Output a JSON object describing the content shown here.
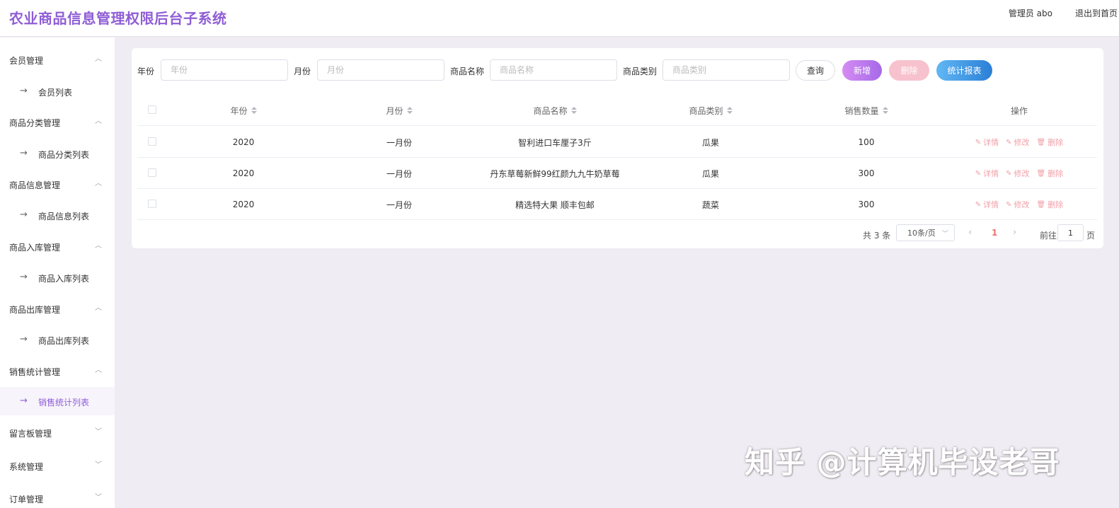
{
  "header": {
    "title": "农业商品信息管理权限后台子系统",
    "user": "管理员 abo",
    "logout": "退出到首页"
  },
  "sidebar": {
    "groups": [
      {
        "title": "会员管理",
        "expanded": true,
        "sub": "会员列表"
      },
      {
        "title": "商品分类管理",
        "expanded": true,
        "sub": "商品分类列表"
      },
      {
        "title": "商品信息管理",
        "expanded": true,
        "sub": "商品信息列表"
      },
      {
        "title": "商品入库管理",
        "expanded": true,
        "sub": "商品入库列表"
      },
      {
        "title": "商品出库管理",
        "expanded": true,
        "sub": "商品出库列表"
      },
      {
        "title": "销售统计管理",
        "expanded": true,
        "sub": "销售统计列表",
        "active": true
      },
      {
        "title": "留言板管理",
        "expanded": false
      },
      {
        "title": "系统管理",
        "expanded": false
      },
      {
        "title": "订单管理",
        "expanded": false
      }
    ]
  },
  "filters": {
    "year_label": "年份",
    "year_placeholder": "年份",
    "month_label": "月份",
    "month_placeholder": "月份",
    "name_label": "商品名称",
    "name_placeholder": "商品名称",
    "category_label": "商品类别",
    "category_placeholder": "商品类别"
  },
  "buttons": {
    "query": "查询",
    "add": "新增",
    "delete": "删除",
    "stats": "统计报表"
  },
  "table": {
    "columns": [
      "年份",
      "月份",
      "商品名称",
      "商品类别",
      "销售数量",
      "操作"
    ],
    "rows": [
      {
        "year": "2020",
        "month": "一月份",
        "name": "智利进口车厘子3斤",
        "category": "瓜果",
        "qty": "100"
      },
      {
        "year": "2020",
        "month": "一月份",
        "name": "丹东草莓新鲜99红颜九九牛奶草莓",
        "category": "瓜果",
        "qty": "300"
      },
      {
        "year": "2020",
        "month": "一月份",
        "name": "精选特大果 顺丰包邮",
        "category": "蔬菜",
        "qty": "300"
      }
    ],
    "actions": {
      "detail": "详情",
      "edit": "修改",
      "delete": "删除"
    }
  },
  "pagination": {
    "total": "共 3 条",
    "page_size": "10条/页",
    "current": "1",
    "goto": "前往",
    "page_input": "1",
    "page_unit": "页"
  },
  "watermark": "知乎 @计算机毕设老哥",
  "colors": {
    "brand": "#8f5ed6",
    "danger": "#f0a0a8",
    "accent_blue": "#2a7fd6"
  }
}
